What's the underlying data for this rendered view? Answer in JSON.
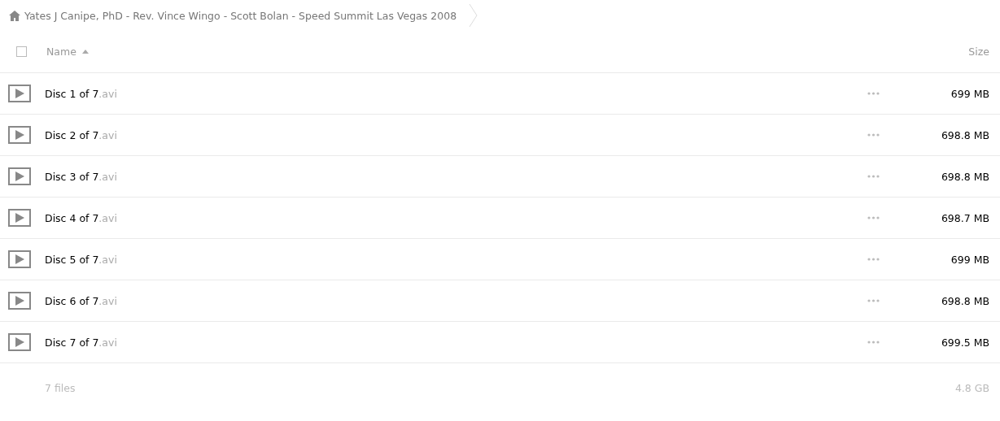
{
  "breadcrumb": {
    "title": "Yates J Canipe, PhD - Rev. Vince Wingo - Scott Bolan - Speed Summit Las Vegas 2008"
  },
  "table": {
    "select_all": {
      "checked": false
    },
    "columns": [
      "Name",
      "Size"
    ],
    "rows": [
      {
        "name": "Disc 1 of 7",
        "extension": ".avi",
        "size": "699 MB"
      },
      {
        "name": "Disc 2 of 7",
        "extension": ".avi",
        "size": "698.8 MB"
      },
      {
        "name": "Disc 3 of 7",
        "extension": ".avi",
        "size": "698.8 MB"
      },
      {
        "name": "Disc 4 of 7",
        "extension": ".avi",
        "size": "698.7 MB"
      },
      {
        "name": "Disc 5 of 7",
        "extension": ".avi",
        "size": "699 MB"
      },
      {
        "name": "Disc 6 of 7",
        "extension": ".avi",
        "size": "698.8 MB"
      },
      {
        "name": "Disc 7 of 7",
        "extension": ".avi",
        "size": "699.5 MB"
      }
    ]
  },
  "summary": {
    "count": "7 files",
    "total": "4.8 GB"
  }
}
